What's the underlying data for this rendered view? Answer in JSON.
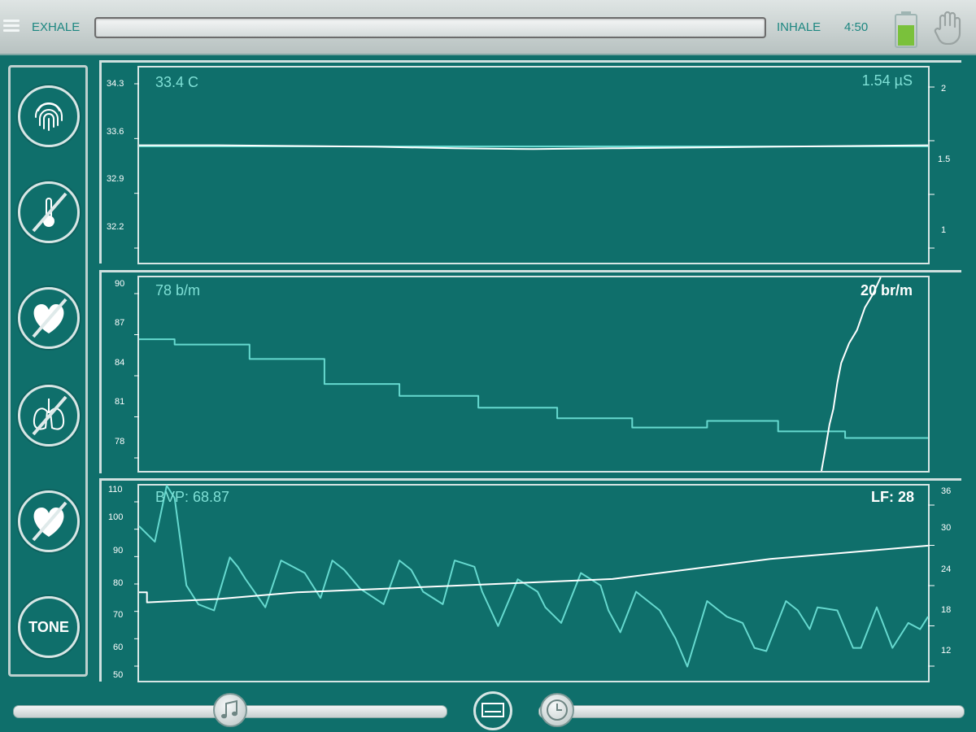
{
  "topbar": {
    "exhale_label": "EXHALE",
    "inhale_label": "INHALE",
    "timer": "4:50",
    "battery_color": "#7ac13b"
  },
  "sidebar": {
    "tone_label": "TONE",
    "buttons": [
      "fingerprint-icon",
      "thermometer-off-icon",
      "heart-off-icon",
      "lungs-off-icon",
      "hrv-off-icon",
      "tone-button"
    ]
  },
  "panels": {
    "temp": {
      "value": "33.4 C",
      "right_value": "1.54 µS",
      "left_ticks": [
        "34.3",
        "33.6",
        "32.9",
        "32.2"
      ],
      "right_ticks": [
        "2",
        "1.5",
        "1"
      ]
    },
    "hr": {
      "value": "78 b/m",
      "right_value": "20 br/m",
      "left_ticks": [
        "90",
        "87",
        "84",
        "81",
        "78"
      ]
    },
    "bvp": {
      "value": "BVP: 68.87",
      "right_value": "LF: 28",
      "left_ticks": [
        "110",
        "100",
        "90",
        "80",
        "70",
        "60",
        "50"
      ],
      "right_ticks": [
        "36",
        "30",
        "24",
        "18",
        "12"
      ]
    }
  },
  "colors": {
    "background": "#0f6f6b",
    "trace_cyan": "#66d9cf",
    "trace_white": "#ffffff",
    "label_cyan": "#7fe0d6"
  },
  "chart_data": [
    {
      "type": "line",
      "series": [
        {
          "x": [
            0,
            0.1,
            0.2,
            0.3,
            0.4,
            0.5,
            0.6,
            0.7,
            0.8,
            0.9,
            1.0
          ],
          "values": [
            33.4,
            33.4,
            33.4,
            33.4,
            33.4,
            33.4,
            33.4,
            33.4,
            33.4,
            33.4,
            33.4
          ]
        },
        {
          "x": [
            0,
            0.1,
            0.2,
            0.3,
            0.4,
            0.5,
            0.6,
            0.7,
            0.8,
            0.9,
            1.0
          ],
          "values": [
            1.54,
            1.54,
            1.535,
            1.53,
            1.52,
            1.515,
            1.52,
            1.525,
            1.53,
            1.535,
            1.54
          ]
        }
      ],
      "ylim": [
        31.8,
        34.5
      ],
      "y2lim": [
        0.78,
        2.05
      ]
    },
    {
      "type": "line",
      "series": [
        {
          "x": [
            0,
            0.045,
            0.045,
            0.14,
            0.14,
            0.235,
            0.235,
            0.33,
            0.33,
            0.43,
            0.43,
            0.53,
            0.53,
            0.625,
            0.625,
            0.72,
            0.72,
            0.81,
            0.81,
            0.895,
            0.895,
            1.0
          ],
          "values": [
            85.8,
            85.8,
            85.4,
            85.4,
            84.3,
            84.3,
            82.4,
            82.4,
            81.5,
            81.5,
            80.6,
            80.6,
            79.8,
            79.8,
            79.1,
            79.1,
            79.6,
            79.6,
            78.8,
            78.8,
            78.3,
            78.3
          ]
        },
        {
          "x": [
            0.865,
            0.87,
            0.875,
            0.88,
            0.885,
            0.89,
            0.9,
            0.91,
            0.92,
            0.93,
            0.94
          ],
          "values": [
            75.8,
            77.5,
            79.3,
            80.5,
            82.5,
            84,
            85.5,
            86.5,
            88.2,
            89.2,
            90.5
          ]
        }
      ],
      "ylim": [
        75.8,
        90.5
      ]
    },
    {
      "type": "line",
      "series": [
        {
          "x": [
            0,
            0.02,
            0.035,
            0.045,
            0.06,
            0.075,
            0.095,
            0.115,
            0.125,
            0.135,
            0.16,
            0.18,
            0.21,
            0.23,
            0.245,
            0.26,
            0.28,
            0.31,
            0.33,
            0.345,
            0.36,
            0.385,
            0.4,
            0.425,
            0.435,
            0.455,
            0.48,
            0.505,
            0.515,
            0.535,
            0.56,
            0.585,
            0.595,
            0.61,
            0.63,
            0.66,
            0.68,
            0.695,
            0.72,
            0.745,
            0.765,
            0.78,
            0.795,
            0.82,
            0.835,
            0.85,
            0.86,
            0.885,
            0.905,
            0.915,
            0.935,
            0.955,
            0.975,
            0.99,
            1.0
          ],
          "values": [
            99,
            94,
            112,
            108,
            80,
            74,
            72,
            89,
            86,
            82,
            73,
            88,
            84,
            76,
            88,
            85,
            79,
            74,
            88,
            85,
            78,
            74,
            88,
            86,
            78,
            67,
            82,
            78,
            73,
            68,
            84,
            80,
            72,
            65,
            78,
            72,
            63,
            54,
            75,
            70,
            68,
            60,
            59,
            75,
            72,
            66,
            73,
            72,
            60,
            60,
            73,
            60,
            68,
            66,
            70
          ]
        },
        {
          "x": [
            0,
            0.01,
            0.01,
            0.1,
            0.2,
            0.3,
            0.4,
            0.5,
            0.6,
            0.7,
            0.8,
            0.9,
            1.0
          ],
          "values": [
            21,
            21,
            19.5,
            20,
            21,
            21.5,
            22,
            22.5,
            23,
            24.5,
            26,
            27,
            28
          ]
        }
      ],
      "ylim": [
        50,
        112
      ],
      "y2lim": [
        8,
        37
      ]
    }
  ]
}
